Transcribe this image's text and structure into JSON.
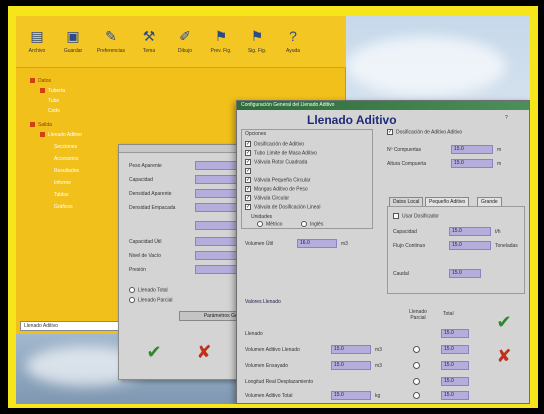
{
  "app": {
    "toolbar": [
      {
        "label": "Archivo",
        "icon": "folder-icon"
      },
      {
        "label": "Guardar",
        "icon": "save-icon"
      },
      {
        "label": "Preferencias",
        "icon": "preferences-icon"
      },
      {
        "label": "Tema",
        "icon": "tools-icon"
      },
      {
        "label": "Dibujo",
        "icon": "draw-icon"
      },
      {
        "label": "Prev. Fig.",
        "icon": "flag-icon"
      },
      {
        "label": "Sig. Fig.",
        "icon": "flag-icon"
      },
      {
        "label": "Ayuda",
        "icon": "help-icon"
      }
    ],
    "tree": [
      {
        "label": "Datos",
        "style": "dark"
      },
      {
        "label": "Tubería",
        "style": "light"
      },
      {
        "label": "Tubo",
        "style": "light"
      },
      {
        "label": "Codo",
        "style": "light"
      },
      {
        "label": "Salida",
        "style": "dark"
      },
      {
        "label": "Llenado Aditivo",
        "style": "light"
      },
      {
        "label": "Secciones",
        "style": "light"
      },
      {
        "label": "Accesorios",
        "style": "light"
      },
      {
        "label": "Resultados",
        "style": "light"
      },
      {
        "label": "Informe",
        "style": "light"
      },
      {
        "label": "Tablas",
        "style": "light"
      },
      {
        "label": "Gráficos",
        "style": "light"
      }
    ],
    "status": "Llenado Aditivo"
  },
  "midform": {
    "rows": [
      "Peso Aparente",
      "Capacidad",
      "Densidad Aparente",
      "Densidad Empacada",
      "Capacidad Útil",
      "Nivel de Vacío",
      "Presión"
    ],
    "radios": [
      "Llenado Total",
      "Llenado Parcial"
    ],
    "wide_button": "Parámetros Generales",
    "accept_glyph": "✔",
    "cancel_glyph": "✘"
  },
  "dialog": {
    "title": "Configuración General del Llenado Aditivo",
    "heading": "Llenado Aditivo",
    "group_label": "Opciones",
    "checks": [
      {
        "label": "Dosificación de Aditivo",
        "checked": true
      },
      {
        "label": "Tubo Límite de Masa Aditivo",
        "checked": true
      },
      {
        "label": "Válvula Rotor Cuadrada",
        "checked": true
      },
      {
        "label": "",
        "checked": true
      },
      {
        "label": "Válvula Pequeña Circular",
        "checked": true
      },
      {
        "label": "Mangas Aditivo de Peso",
        "checked": true
      },
      {
        "label": "Válvula Circular",
        "checked": true
      },
      {
        "label": "Válvula de Dosificación Lineal",
        "checked": true
      }
    ],
    "units_group": "Unidades",
    "units_options": [
      "Métrico",
      "Inglés"
    ],
    "vol_label": "Volumen Útil",
    "vol_value": "16.0",
    "vol_unit": "m3",
    "right_check": "Dosificación de Aditivo Aditivo",
    "right_fields": [
      {
        "label": "Nº Compuertas",
        "value": "15.0",
        "unit": "m"
      },
      {
        "label": "Altura Compuerta",
        "value": "15.0",
        "unit": "m"
      }
    ],
    "tabs": [
      "Datos Local",
      "Pequeño Aditivo",
      "Grande"
    ],
    "tab_check": "Usar Dosificador",
    "tab_fields": [
      {
        "label": "Capacidad",
        "value": "15.0",
        "unit": "t/h"
      },
      {
        "label": "Flujo Continuo",
        "value": "15.0",
        "unit": "Toneladas"
      }
    ],
    "tab_lower_label": "Caudal",
    "tab_lower_value": "15.0",
    "bottom_title": "Valores Llenado",
    "col_headers": [
      "Llenado Parcial",
      "Total"
    ],
    "bottom_rows": [
      {
        "label": "Llenado",
        "value": "",
        "unit": "",
        "t1": "15.0"
      },
      {
        "label": "Volumen Aditivo Llenado",
        "value": "15.0",
        "unit": "m3",
        "t1": "15.0"
      },
      {
        "label": "Volumen Ensayado",
        "value": "15.0",
        "unit": "m3",
        "t1": "15.0"
      },
      {
        "label": "Longitud Real Desplazamiento",
        "value": "",
        "unit": "",
        "t1": "15.0"
      },
      {
        "label": "Volumen Aditivo Total",
        "value": "15.0",
        "unit": "kg",
        "t1": "15.0"
      }
    ],
    "accept_glyph": "✔",
    "cancel_glyph": "✘"
  },
  "colors": {
    "frame": "#f5e51a",
    "app_yellow": "#f2c01a",
    "field_fill": "#b5aedc",
    "heading_blue": "#1e2a78",
    "titlebar_green": "#2c6b3a",
    "accept_green": "#2c8a2c",
    "cancel_red": "#c0301a"
  }
}
